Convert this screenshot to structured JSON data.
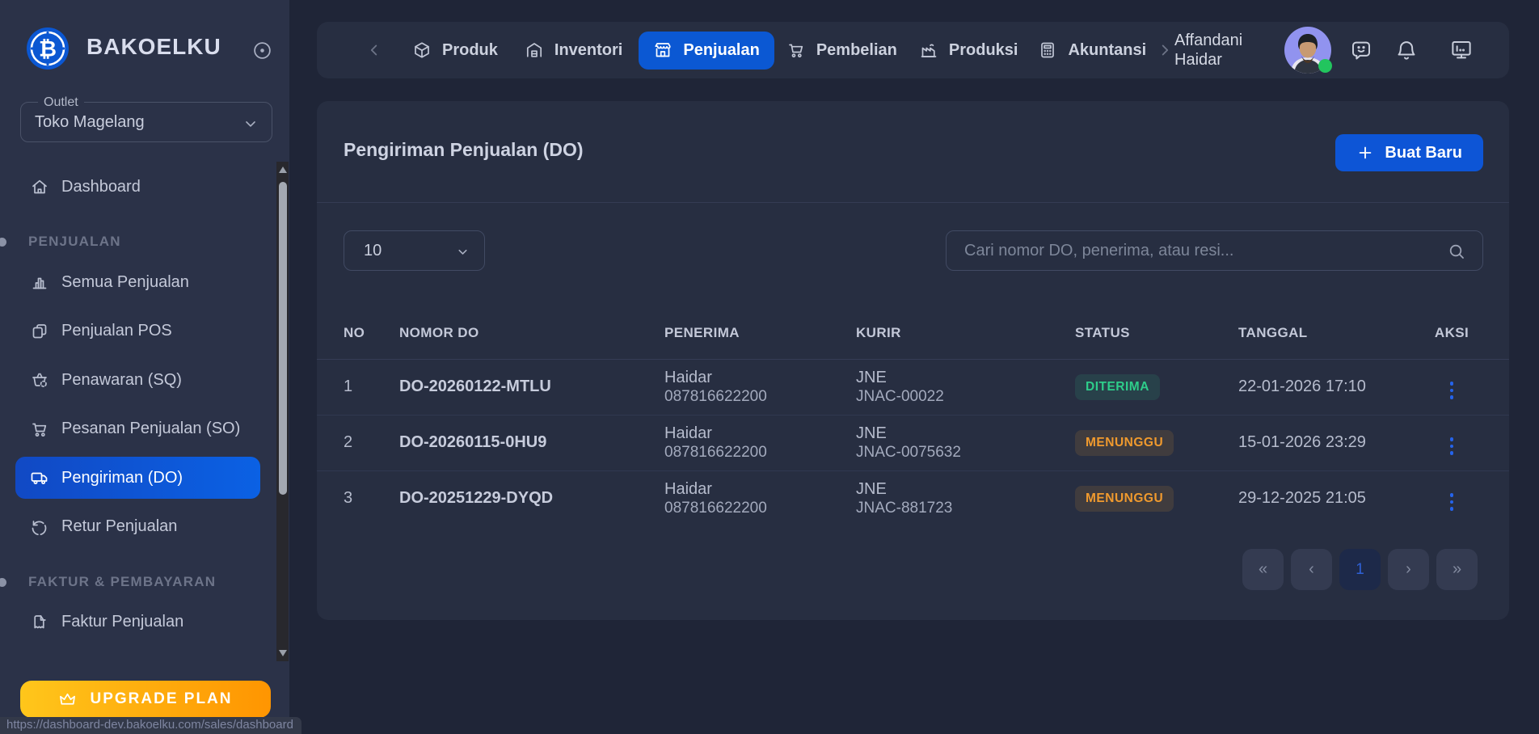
{
  "app": {
    "brand": "BAKOELKU"
  },
  "sidebar": {
    "outlet": {
      "label": "Outlet",
      "value": "Toko Magelang"
    },
    "items": [
      {
        "label": "Dashboard",
        "icon": "home"
      },
      {
        "label": "PENJUALAN",
        "type": "header"
      },
      {
        "label": "Semua Penjualan",
        "icon": "bar-chart"
      },
      {
        "label": "Penjualan POS",
        "icon": "pos"
      },
      {
        "label": "Penawaran (SQ)",
        "icon": "basket-clock"
      },
      {
        "label": "Pesanan Penjualan (SO)",
        "icon": "cart"
      },
      {
        "label": "Pengiriman (DO)",
        "icon": "truck",
        "active": true
      },
      {
        "label": "Retur Penjualan",
        "icon": "rotate-ccw"
      },
      {
        "label": "FAKTUR & PEMBAYARAN",
        "type": "header"
      },
      {
        "label": "Faktur Penjualan",
        "icon": "file"
      }
    ],
    "upgrade": {
      "label": "UPGRADE PLAN"
    }
  },
  "statusbar": {
    "url": "https://dashboard-dev.bakoelku.com/sales/dashboard"
  },
  "topnav": {
    "tabs": [
      {
        "label": "Produk",
        "icon": "package"
      },
      {
        "label": "Inventori",
        "icon": "warehouse"
      },
      {
        "label": "Penjualan",
        "icon": "store",
        "active": true
      },
      {
        "label": "Pembelian",
        "icon": "cart"
      },
      {
        "label": "Produksi",
        "icon": "factory"
      },
      {
        "label": "Akuntansi",
        "icon": "calculator"
      }
    ],
    "user": {
      "line1": "Affandani",
      "line2": "Haidar"
    }
  },
  "panel": {
    "title": "Pengiriman Penjualan (DO)",
    "create_label": "Buat Baru",
    "page_size": "10",
    "search_placeholder": "Cari nomor DO, penerima, atau resi..."
  },
  "table": {
    "headers": [
      "NO",
      "NOMOR DO",
      "PENERIMA",
      "KURIR",
      "STATUS",
      "TANGGAL",
      "AKSI"
    ],
    "rows": [
      {
        "no": "1",
        "nomor": "DO-20260122-MTLU",
        "penerima_nama": "Haidar",
        "penerima_telp": "087816622200",
        "kurir": "JNE",
        "resi": "JNAC-00022",
        "status": "DITERIMA",
        "tanggal": "22-01-2026 17:10"
      },
      {
        "no": "2",
        "nomor": "DO-20260115-0HU9",
        "penerima_nama": "Haidar",
        "penerima_telp": "087816622200",
        "kurir": "JNE",
        "resi": "JNAC-0075632",
        "status": "MENUNGGU",
        "tanggal": "15-01-2026 23:29"
      },
      {
        "no": "3",
        "nomor": "DO-20251229-DYQD",
        "penerima_nama": "Haidar",
        "penerima_telp": "087816622200",
        "kurir": "JNE",
        "resi": "JNAC-881723",
        "status": "MENUNGGU",
        "tanggal": "29-12-2025 21:05"
      }
    ]
  },
  "pagination": {
    "first": "«",
    "prev": "‹",
    "page": "1",
    "next": "›",
    "last": "»"
  },
  "colors": {
    "accent_blue": "#0d55d6",
    "status_diterima": "#2ecd8a",
    "status_menunggu": "#f09a2e",
    "upgrade_from": "#ffc61b",
    "upgrade_to": "#ff9501",
    "online": "#22c55e"
  }
}
